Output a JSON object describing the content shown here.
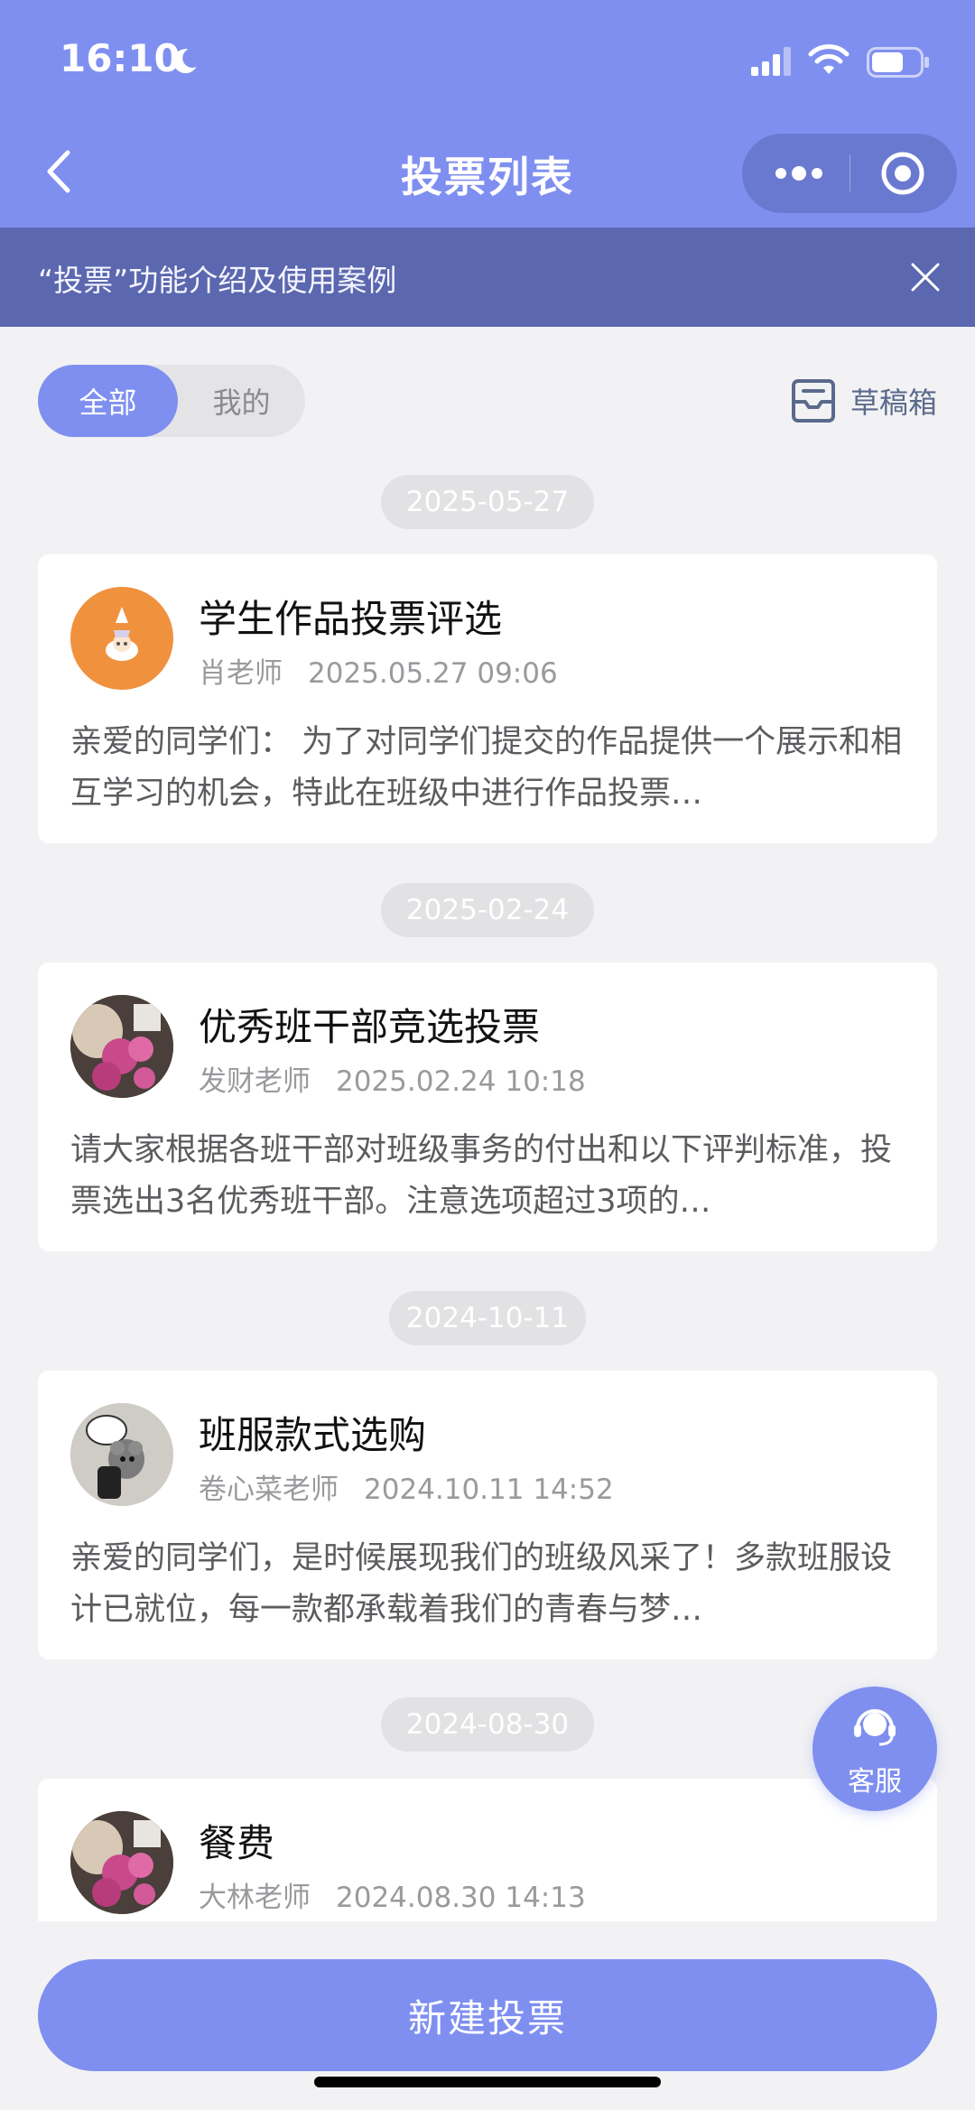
{
  "status": {
    "time": "16:10"
  },
  "nav": {
    "title": "投票列表"
  },
  "banner": {
    "text": "“投票”功能介绍及使用案例"
  },
  "filters": {
    "all": "全部",
    "mine": "我的"
  },
  "drafts": {
    "label": "草稿箱"
  },
  "items": [
    {
      "date": "2025-05-27",
      "title": "学生作品投票评选",
      "author": "肖老师",
      "time": "2025.05.27 09:06",
      "desc": "亲爱的同学们： 为了对同学们提交的作品提供一个展示和相互学习的机会，特此在班级中进行作品投票…"
    },
    {
      "date": "2025-02-24",
      "title": "优秀班干部竞选投票",
      "author": "发财老师",
      "time": "2025.02.24 10:18",
      "desc": "请大家根据各班干部对班级事务的付出和以下评判标准，投票选出3名优秀班干部。注意选项超过3项的…"
    },
    {
      "date": "2024-10-11",
      "title": "班服款式选购",
      "author": "卷心菜老师",
      "time": "2024.10.11 14:52",
      "desc": "亲爱的同学们，是时候展现我们的班级风采了！多款班服设计已就位，每一款都承载着我们的青春与梦…"
    },
    {
      "date": "2024-08-30",
      "title": "餐费",
      "author": "大林老师",
      "time": "2024.08.30 14:13",
      "desc": ""
    }
  ],
  "service": {
    "label": "客服"
  },
  "actions": {
    "new_vote": "新建投票"
  },
  "colors": {
    "primary": "#7f8ff0",
    "banner": "#5b67ae",
    "background": "#f2f2f4"
  }
}
